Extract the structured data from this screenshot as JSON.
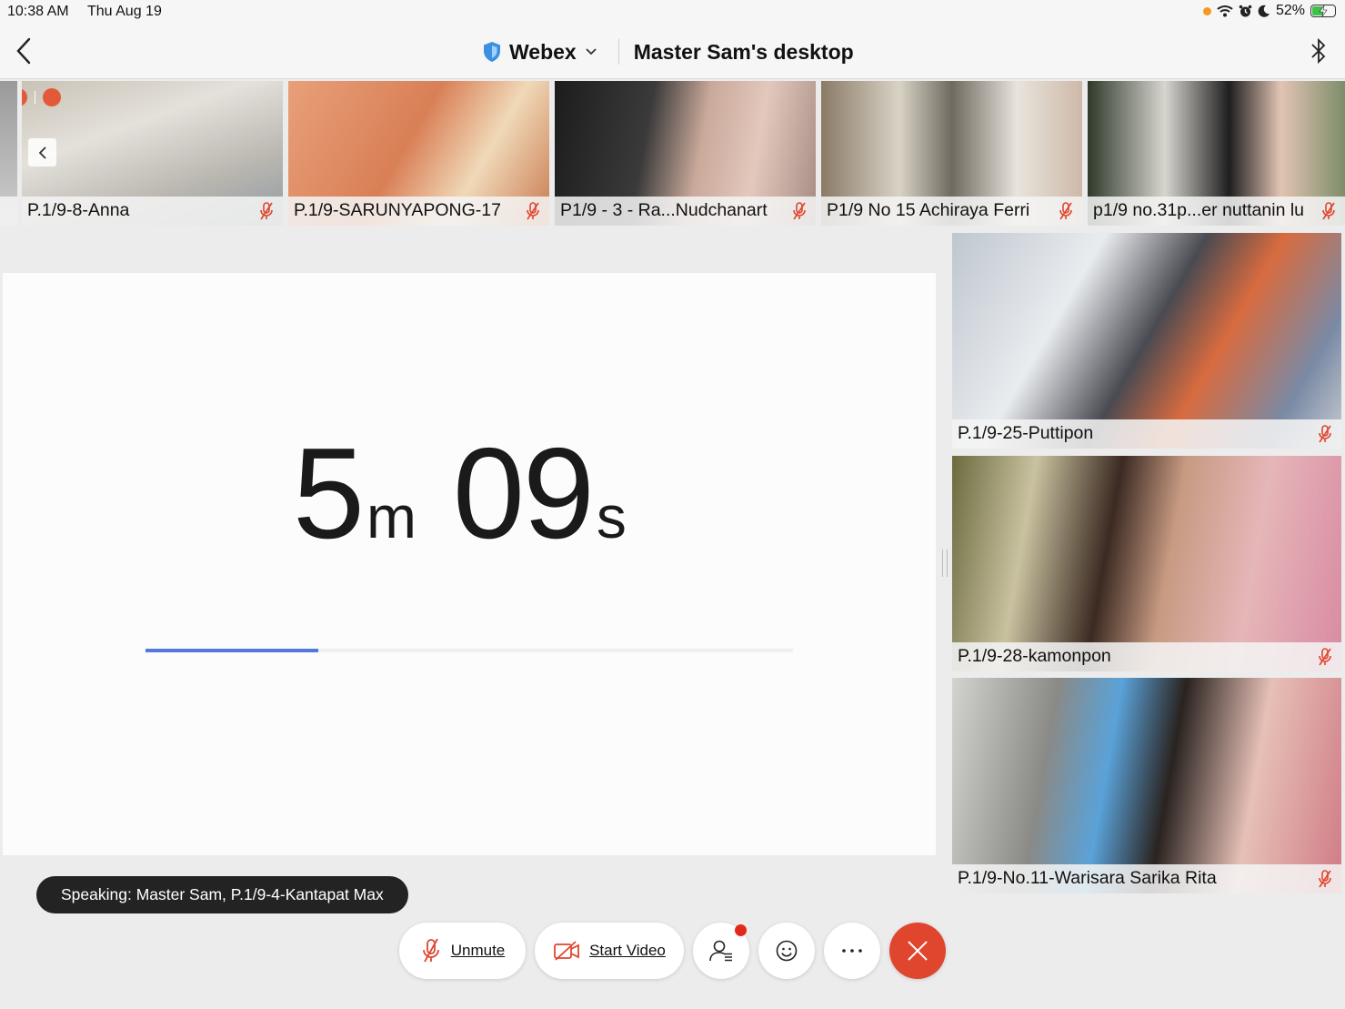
{
  "status_bar": {
    "time": "10:38 AM",
    "date": "Thu Aug 19",
    "battery_text": "52%",
    "battery_level": 0.52
  },
  "header": {
    "app_name": "Webex",
    "share_title": "Master Sam's desktop"
  },
  "filmstrip": [
    {
      "name": "P.1/9-8-Anna"
    },
    {
      "name": "P.1/9-SARUNYAPONG-17"
    },
    {
      "name": "P1/9 - 3 - Ra...Nudchanart"
    },
    {
      "name": "P1/9 No 15 Achiraya Ferri"
    },
    {
      "name": "p1/9 no.31p...er nuttanin lu"
    }
  ],
  "side_videos": [
    {
      "name": "P.1/9-25-Puttipon"
    },
    {
      "name": "P.1/9-28-kamonpon"
    },
    {
      "name": "P.1/9-No.11-Warisara Sarika Rita"
    }
  ],
  "shared_content": {
    "minutes": "5",
    "minutes_unit": "m",
    "seconds": "09",
    "seconds_unit": "s",
    "progress_fraction": 0.267
  },
  "speaking": "Speaking: Master Sam, P.1/9-4-Kantapat Max",
  "controls": {
    "unmute": "Unmute",
    "start_video": "Start Video"
  },
  "colors": {
    "accent_blue": "#5379dd",
    "end_red": "#e0452e",
    "muted_red": "#e0452e"
  }
}
